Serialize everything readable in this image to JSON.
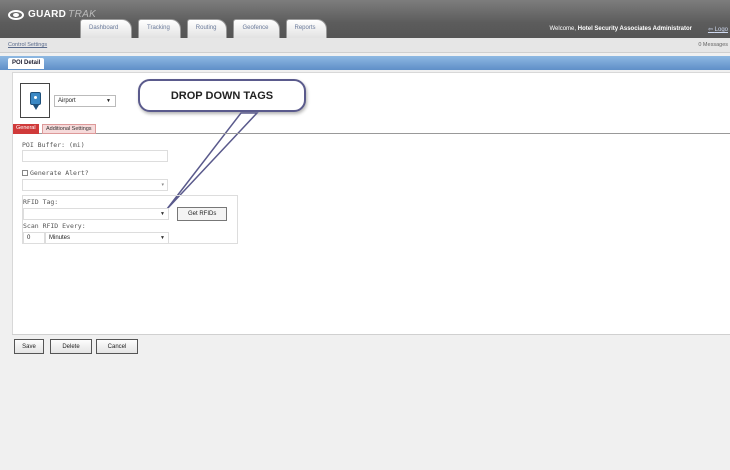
{
  "app": {
    "logo_text": "GUARD",
    "logo_suffix": "TRAK"
  },
  "tabs": [
    "Dashboard",
    "Tracking",
    "Routing",
    "Geofence",
    "Reports"
  ],
  "header": {
    "welcome_prefix": "Welcome,",
    "user": "Hotel Security Associates Administrator",
    "logout": "Logo"
  },
  "subbar": {
    "breadcrumb": "Control Settings",
    "messages": "0 Messages"
  },
  "section": {
    "title": "POI Detail"
  },
  "poi": {
    "icon": "map-pin-icon",
    "type_value": "Airport"
  },
  "callout": {
    "text": "DROP DOWN TAGS"
  },
  "subtabs": [
    "General",
    "Additional Settings"
  ],
  "form": {
    "poi_buffer_label": "POI Buffer: (mi)",
    "poi_buffer_value": "",
    "generate_alert_label": "Generate Alert?",
    "alert_select_value": "",
    "rfid_label": "RFID Tag:",
    "rfid_value": "",
    "get_rfids": "Get RFIDs",
    "scan_label": "Scan RFID Every:",
    "scan_value": "0",
    "scan_unit": "Minutes"
  },
  "footer": {
    "save": "Save",
    "delete": "Delete",
    "cancel": "Cancel"
  },
  "colors": {
    "header": "#5c5c5c",
    "section_bar": "#6f9dd2",
    "active_tab": "#d03a3a",
    "pin": "#3a88c4"
  }
}
